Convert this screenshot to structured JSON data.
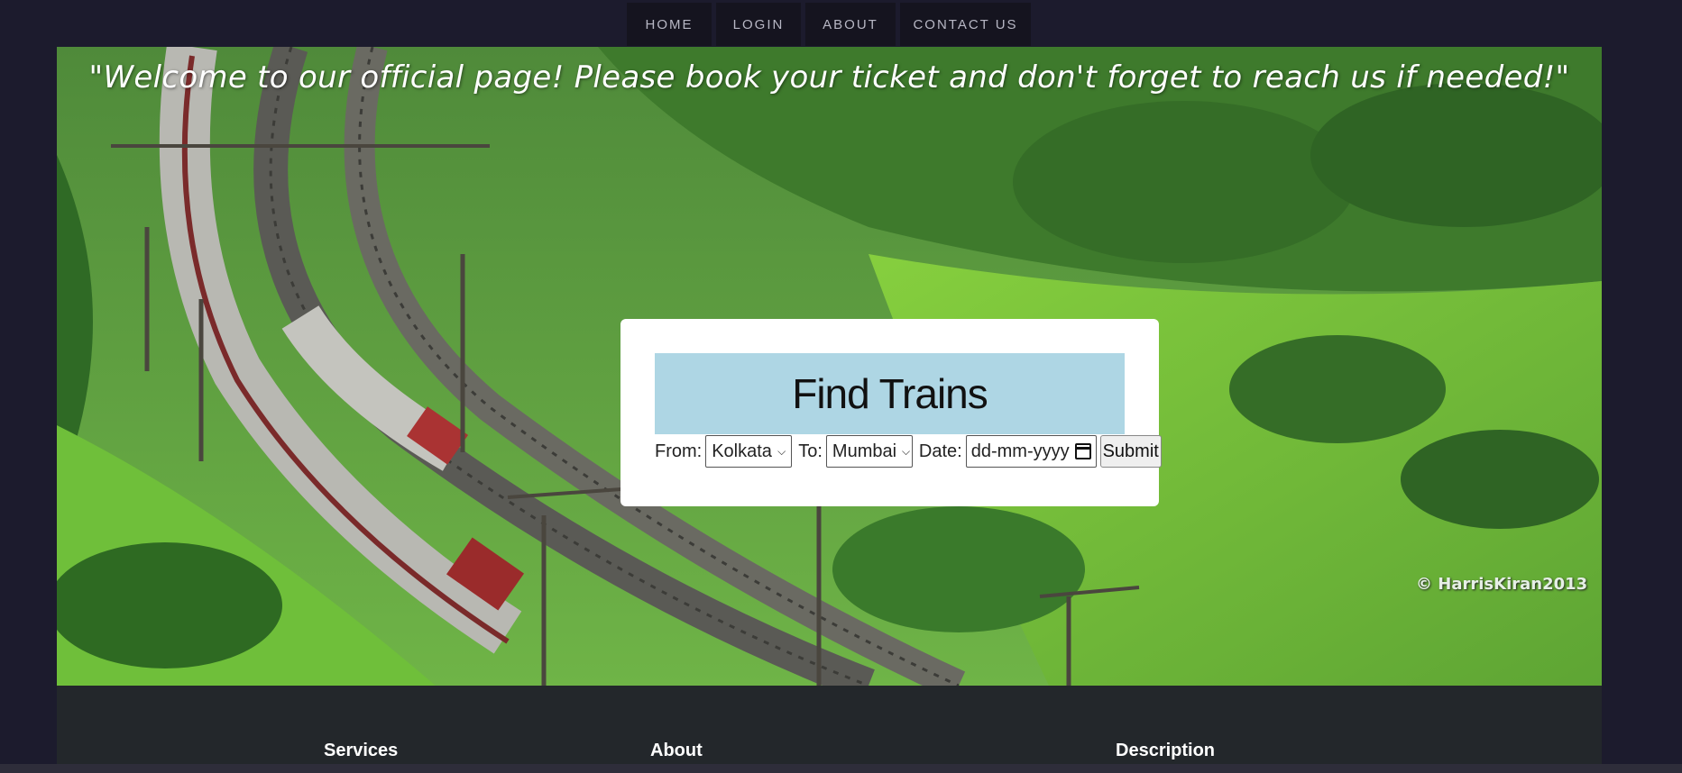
{
  "nav": {
    "home": "HOME",
    "login": "LOGIN",
    "about": "ABOUT",
    "contact": "CONTACT US"
  },
  "hero": {
    "welcome": "\"Welcome to our official page! Please book your ticket and don't forget to reach us if needed!\"",
    "watermark": "© HarrisKiran2013"
  },
  "search": {
    "title": "Find Trains",
    "from_label": "From:",
    "from_value": "Kolkata",
    "to_label": "To:",
    "to_value": "Mumbai",
    "date_label": "Date:",
    "date_placeholder": "dd-mm-yyyy",
    "submit_label": "Submit"
  },
  "footer": {
    "services": "Services",
    "about": "About",
    "description": "Description"
  },
  "colors": {
    "page_bg": "#1c1b2d",
    "nav_bg": "#15141f",
    "title_bg": "#aed6e4",
    "footer_bg": "#23272b"
  }
}
